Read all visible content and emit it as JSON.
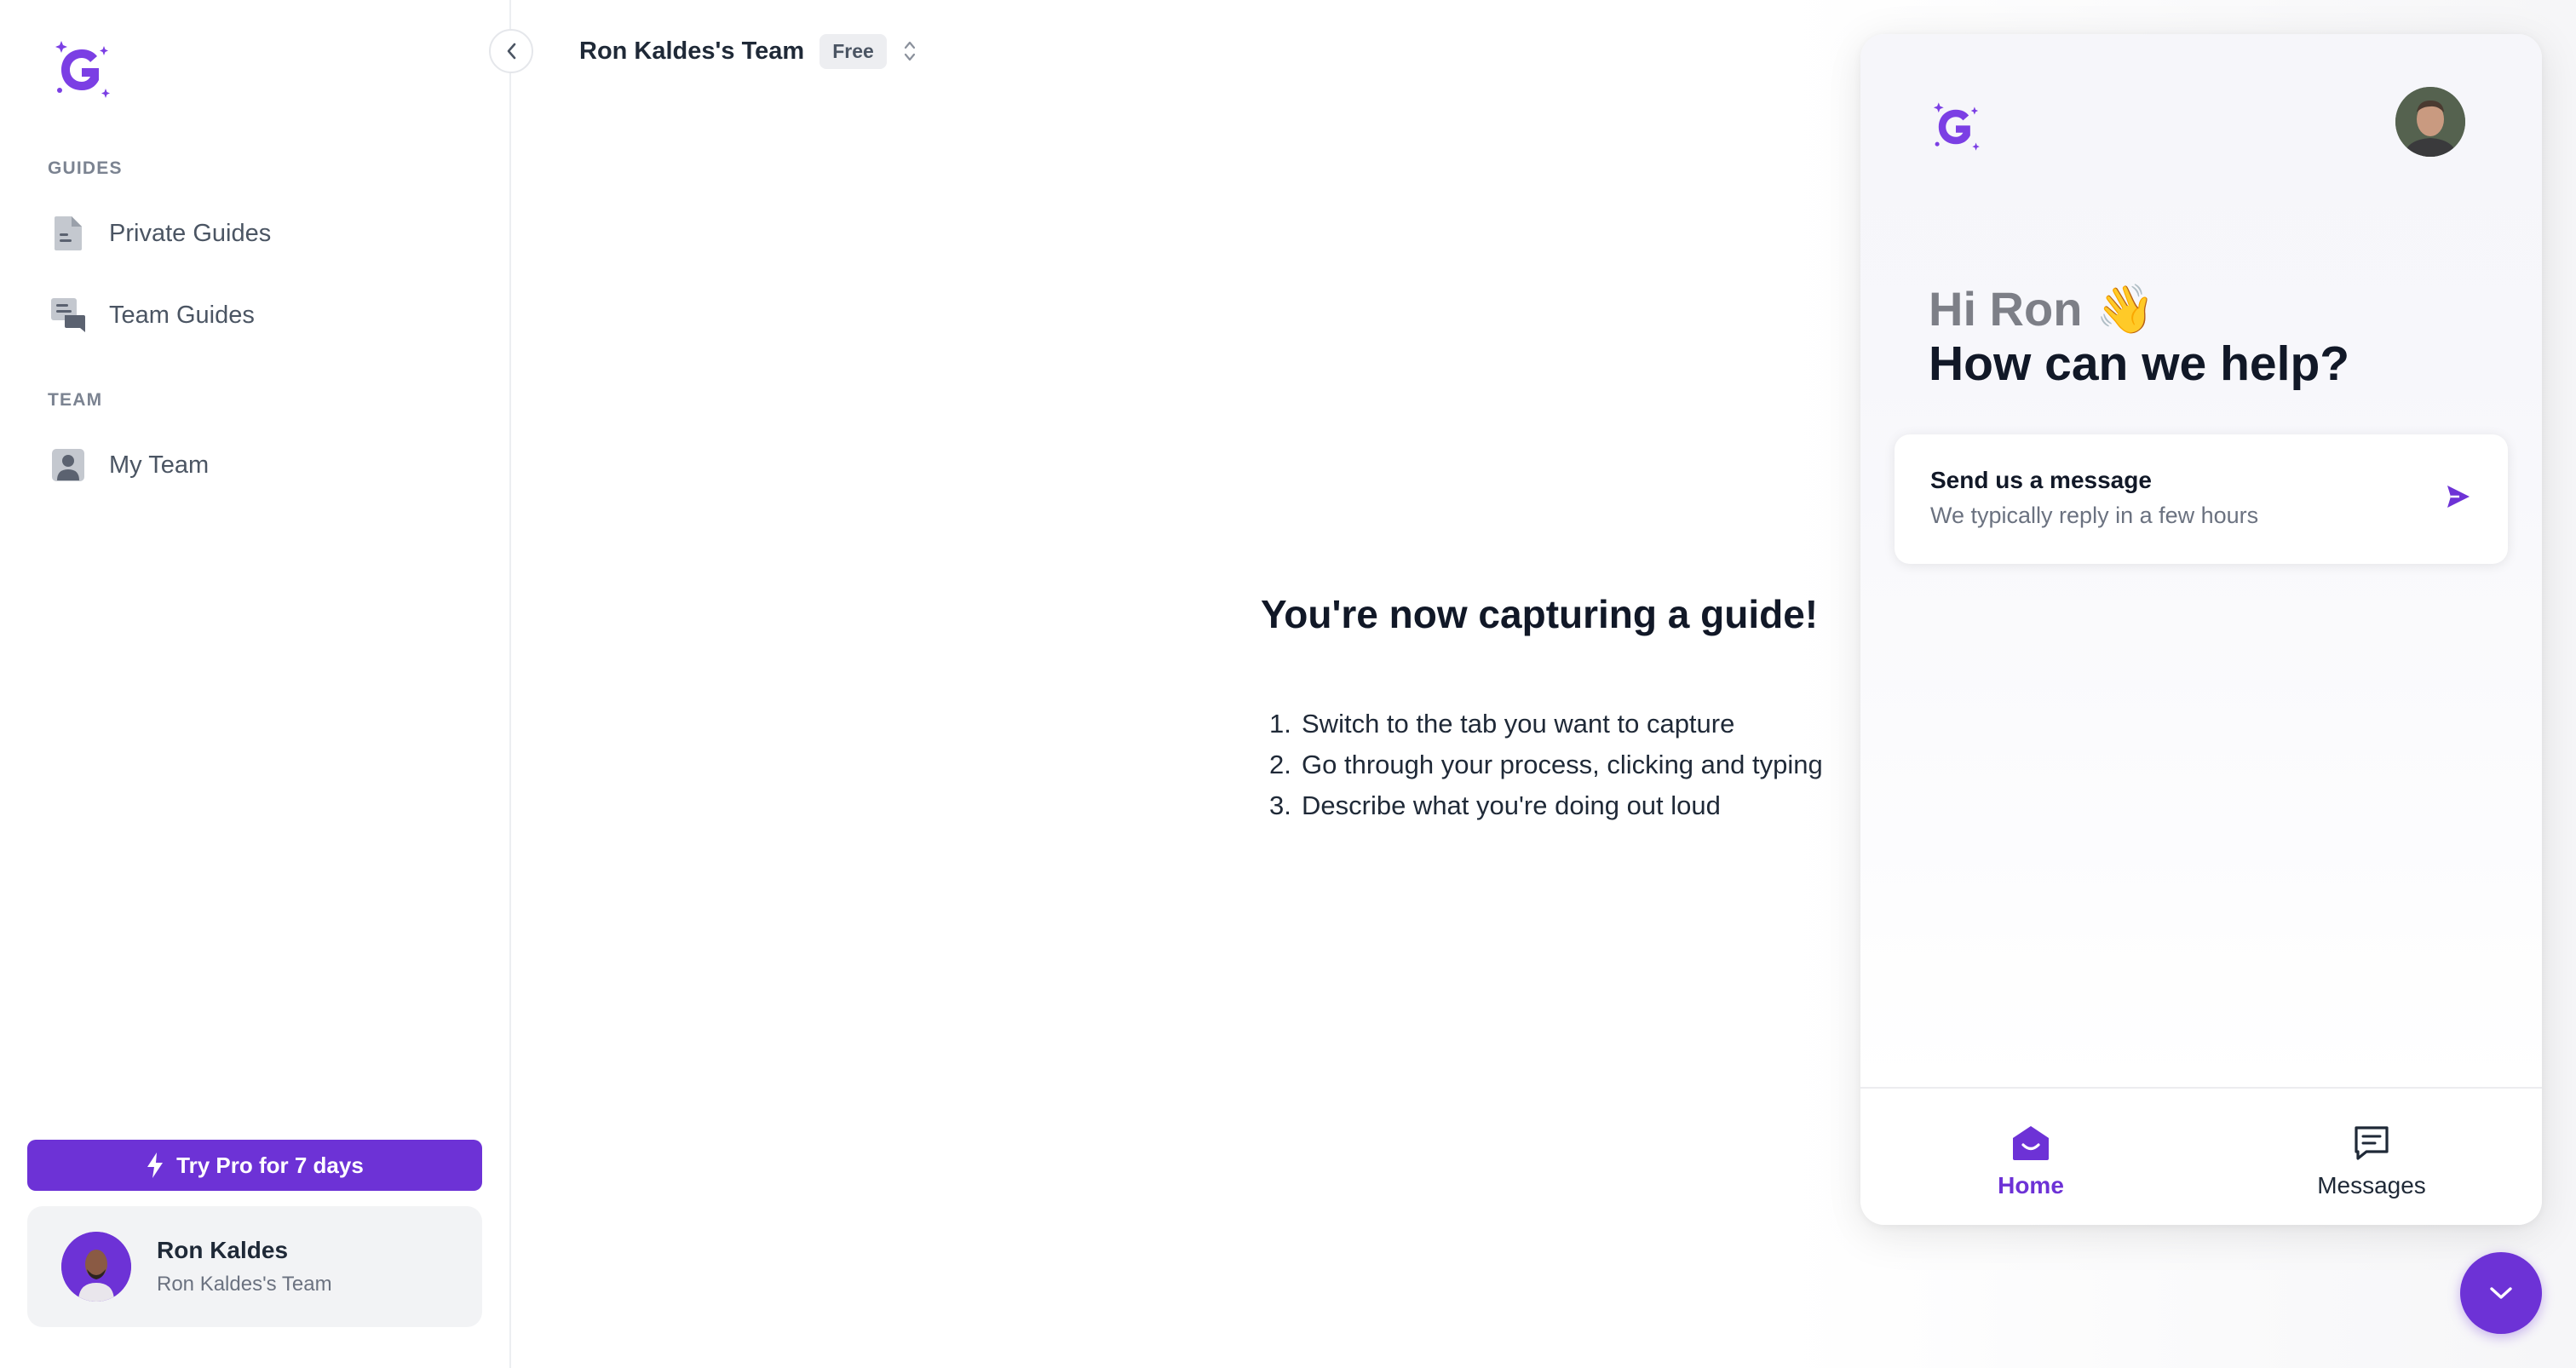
{
  "sidebar": {
    "sections": [
      {
        "label": "GUIDES"
      },
      {
        "label": "TEAM"
      }
    ],
    "items": [
      {
        "label": "Private Guides",
        "icon": "document-icon"
      },
      {
        "label": "Team Guides",
        "icon": "chat-documents-icon"
      },
      {
        "label": "My Team",
        "icon": "person-icon"
      }
    ],
    "try_pro_label": "Try Pro for 7 days",
    "user": {
      "name": "Ron Kaldes",
      "team": "Ron Kaldes's Team"
    }
  },
  "header": {
    "team_name": "Ron Kaldes's Team",
    "plan": "Free"
  },
  "main": {
    "title": "You're now capturing a guide!",
    "steps": [
      {
        "num": "1.",
        "text": "Switch to the tab you want to capture"
      },
      {
        "num": "2.",
        "text": "Go through your process, clicking and typing"
      },
      {
        "num": "3.",
        "text": "Describe what you're doing out loud"
      }
    ]
  },
  "widget": {
    "greeting": "Hi Ron 👋",
    "headline": "How can we help?",
    "message_card": {
      "title": "Send us a message",
      "subtitle": "We typically reply in a few hours"
    },
    "tabs": [
      {
        "label": "Home",
        "active": true
      },
      {
        "label": "Messages",
        "active": false
      }
    ]
  },
  "colors": {
    "accent": "#6d32d6",
    "text_primary": "#111827",
    "text_muted": "#6b7280"
  }
}
